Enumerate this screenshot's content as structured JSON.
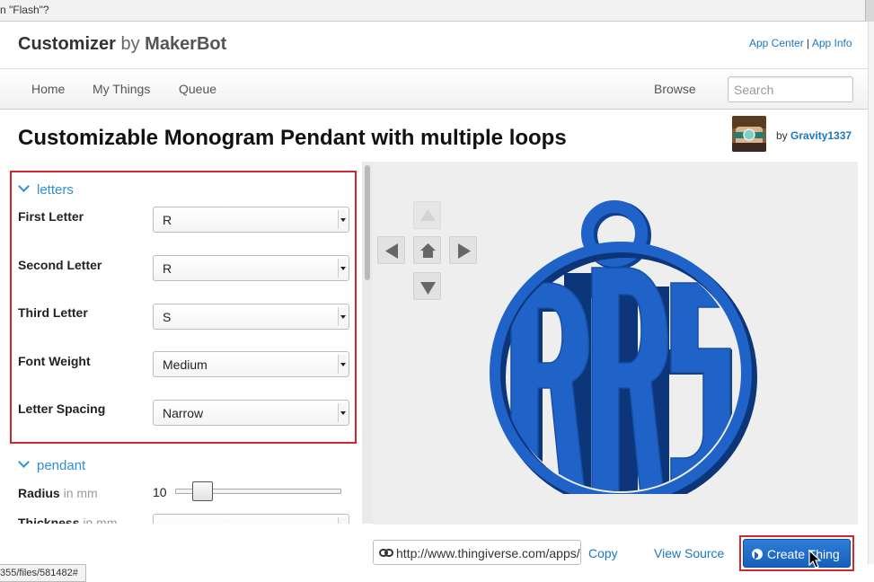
{
  "browser": {
    "top_strip_text": "n \"Flash\"?",
    "status_url": "355/files/581482#"
  },
  "header": {
    "brand_name": "Customizer",
    "brand_by": "by",
    "brand_maker": "MakerBot",
    "app_center": "App Center",
    "separator": "|",
    "app_info": "App Info"
  },
  "nav": {
    "home": "Home",
    "my_things": "My Things",
    "queue": "Queue",
    "browse": "Browse",
    "search_placeholder": "Search"
  },
  "thing": {
    "title": "Customizable Monogram Pendant with multiple loops",
    "by": "by",
    "author": "Gravity1337"
  },
  "panel": {
    "sections": [
      {
        "title": "letters",
        "fields": [
          {
            "label": "First Letter",
            "value": "R"
          },
          {
            "label": "Second Letter",
            "value": "R"
          },
          {
            "label": "Third Letter",
            "value": "S"
          },
          {
            "label": "Font Weight",
            "value": "Medium"
          },
          {
            "label": "Letter Spacing",
            "value": "Narrow"
          }
        ]
      },
      {
        "title": "pendant",
        "radius_label": "Radius",
        "radius_unit": "in mm",
        "radius_value": "10",
        "radius_slider_fraction": 0.12,
        "thickness_label": "Thickness",
        "thickness_unit": "in mm"
      }
    ]
  },
  "viewer": {
    "model_color": "#1f62c8",
    "background_color": "#eeeeee",
    "controls": [
      "arrow-up-icon",
      "arrow-left-icon",
      "home-icon",
      "arrow-right-icon",
      "arrow-down-icon"
    ]
  },
  "footer": {
    "url": "http://www.thingiverse.com/apps/",
    "copy": "Copy",
    "view_source": "View Source",
    "create_thing": "Create Thing",
    "accent_color": "#1d68c8",
    "highlight_color": "#d22630"
  }
}
